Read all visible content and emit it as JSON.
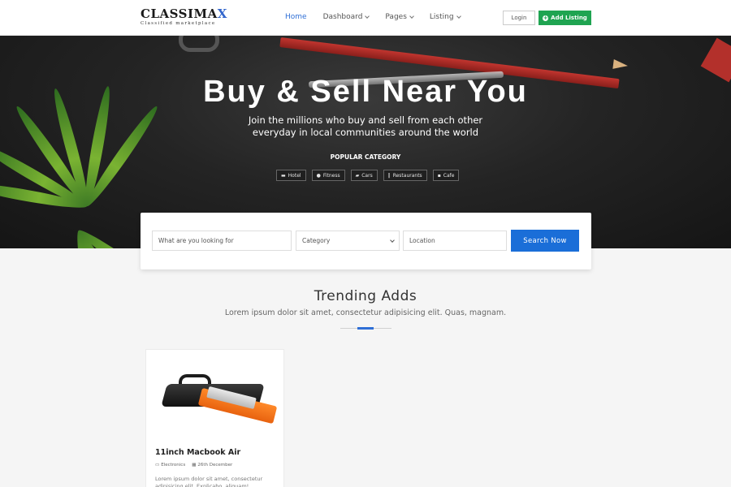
{
  "header": {
    "logo_main": "CLASSIMA",
    "logo_x": "X",
    "logo_sub": "Classified marketplace",
    "nav": [
      {
        "label": "Home",
        "active": true,
        "dropdown": false
      },
      {
        "label": "Dashboard",
        "active": false,
        "dropdown": true
      },
      {
        "label": "Pages",
        "active": false,
        "dropdown": true
      },
      {
        "label": "Listing",
        "active": false,
        "dropdown": true
      }
    ],
    "login_label": "Login",
    "add_listing_label": "Add Listing"
  },
  "hero": {
    "title": "Buy & Sell Near You",
    "subtitle_line1": "Join the millions who buy and sell from each other",
    "subtitle_line2": "everyday in local communities around the world",
    "popular_title": "POPULAR CATEGORY",
    "categories": [
      {
        "label": "Hotel",
        "icon": "bed-icon",
        "glyph": "▬"
      },
      {
        "label": "Fitness",
        "icon": "fitness-icon",
        "glyph": "●"
      },
      {
        "label": "Cars",
        "icon": "car-icon",
        "glyph": "▰"
      },
      {
        "label": "Restaurants",
        "icon": "cutlery-icon",
        "glyph": "‖"
      },
      {
        "label": "Cafe",
        "icon": "coffee-icon",
        "glyph": "▪"
      }
    ]
  },
  "search": {
    "keyword_placeholder": "What are you looking for",
    "category_selected": "Category",
    "location_placeholder": "Location",
    "button_label": "Search Now"
  },
  "trending": {
    "title": "Trending Adds",
    "subtitle": "Lorem ipsum dolor sit amet, consectetur adipisicing elit. Quas, magnam.",
    "cards": [
      {
        "title": "11inch Macbook Air",
        "category": "Electronics",
        "date": "26th December",
        "description": "Lorem ipsum dolor sit amet, consectetur adipisicing elit. Explicabo, aliquam!"
      }
    ]
  },
  "colors": {
    "accent": "#2f6fd6",
    "search_button": "#1a6ed8",
    "add_listing": "#1fa451"
  }
}
